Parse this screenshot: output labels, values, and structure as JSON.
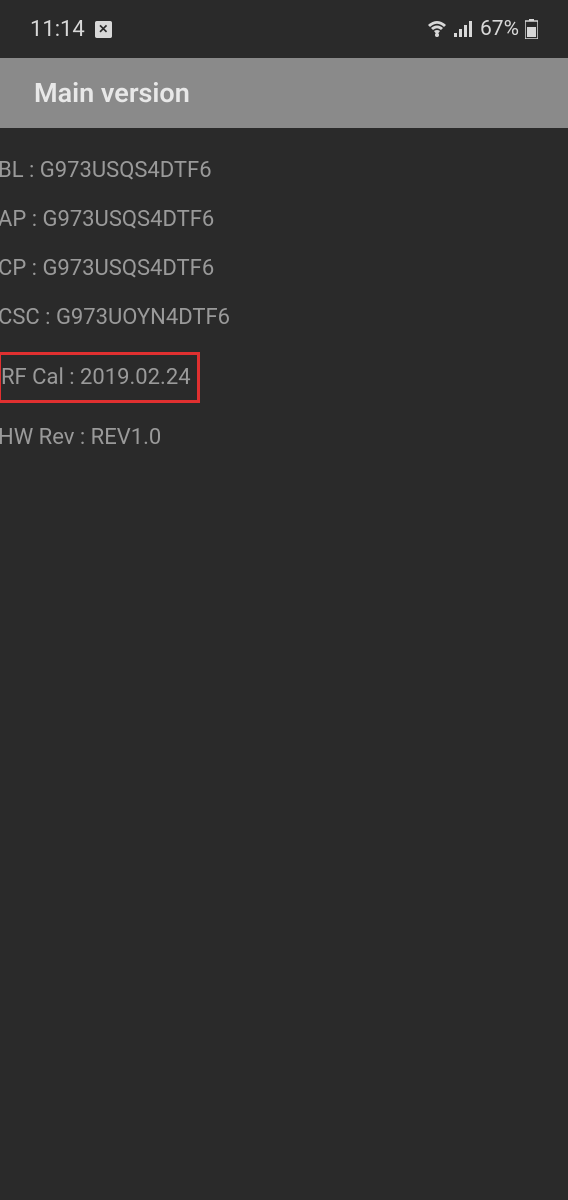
{
  "status_bar": {
    "time": "11:14",
    "battery_percent": "67%"
  },
  "header": {
    "title": "Main version"
  },
  "rows": {
    "bl": "BL : G973USQS4DTF6",
    "ap": "AP : G973USQS4DTF6",
    "cp": "CP :  G973USQS4DTF6",
    "csc": "CSC :  G973UOYN4DTF6",
    "rf_cal": "RF Cal : 2019.02.24",
    "hw_rev": "HW Rev : REV1.0"
  }
}
